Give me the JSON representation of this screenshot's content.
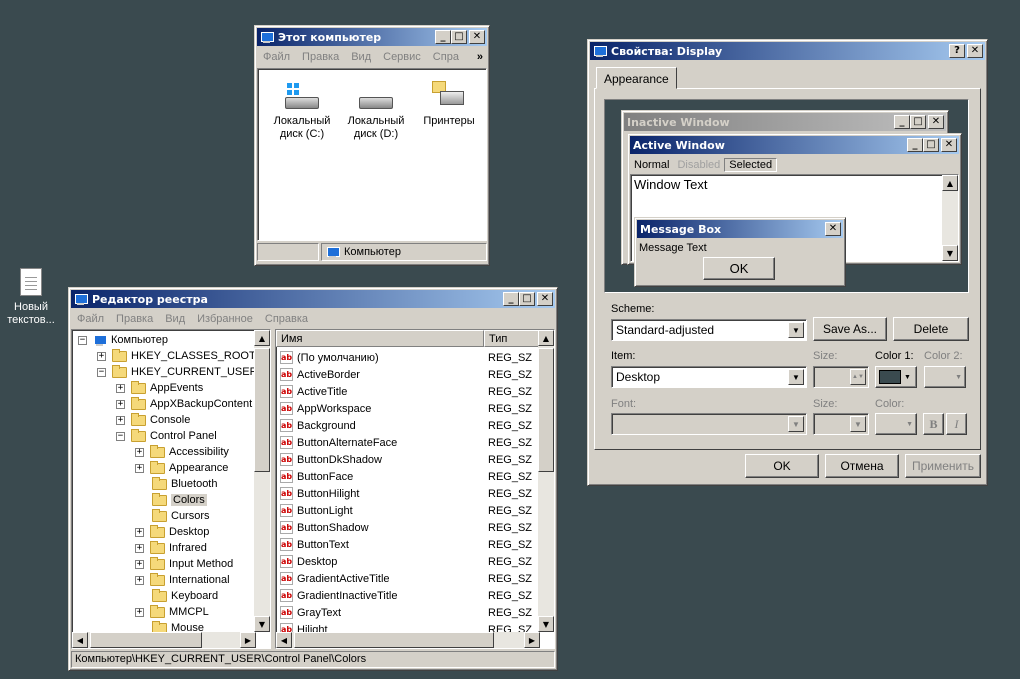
{
  "desktop": {
    "icon_label": "Новый текстов..."
  },
  "computer": {
    "title": "Этот компьютер",
    "menu": [
      "Файл",
      "Правка",
      "Вид",
      "Сервис",
      "Спра"
    ],
    "more": "»",
    "items": [
      "Локальный диск (C:)",
      "Локальный диск (D:)",
      "Принтеры"
    ],
    "status": "Компьютер"
  },
  "regedit": {
    "title": "Редактор реестра",
    "menu": [
      "Файл",
      "Правка",
      "Вид",
      "Избранное",
      "Справка"
    ],
    "tree": [
      {
        "label": "Компьютер",
        "lvl": 0,
        "exp": "−"
      },
      {
        "label": "HKEY_CLASSES_ROOT",
        "lvl": 1,
        "exp": "+"
      },
      {
        "label": "HKEY_CURRENT_USER",
        "lvl": 1,
        "exp": "−"
      },
      {
        "label": "AppEvents",
        "lvl": 2,
        "exp": "+"
      },
      {
        "label": "AppXBackupContent",
        "lvl": 2,
        "exp": "+"
      },
      {
        "label": "Console",
        "lvl": 2,
        "exp": "+"
      },
      {
        "label": "Control Panel",
        "lvl": 2,
        "exp": "−"
      },
      {
        "label": "Accessibility",
        "lvl": 3,
        "exp": "+"
      },
      {
        "label": "Appearance",
        "lvl": 3,
        "exp": "+"
      },
      {
        "label": "Bluetooth",
        "lvl": 3,
        "exp": ""
      },
      {
        "label": "Colors",
        "lvl": 3,
        "exp": "",
        "selected": true
      },
      {
        "label": "Cursors",
        "lvl": 3,
        "exp": ""
      },
      {
        "label": "Desktop",
        "lvl": 3,
        "exp": "+"
      },
      {
        "label": "Infrared",
        "lvl": 3,
        "exp": "+"
      },
      {
        "label": "Input Method",
        "lvl": 3,
        "exp": "+"
      },
      {
        "label": "International",
        "lvl": 3,
        "exp": "+"
      },
      {
        "label": "Keyboard",
        "lvl": 3,
        "exp": ""
      },
      {
        "label": "MMCPL",
        "lvl": 3,
        "exp": "+"
      },
      {
        "label": "Mouse",
        "lvl": 3,
        "exp": ""
      }
    ],
    "col_name": "Имя",
    "col_type": "Тип",
    "values": [
      {
        "name": "(По умолчанию)",
        "type": "REG_SZ"
      },
      {
        "name": "ActiveBorder",
        "type": "REG_SZ"
      },
      {
        "name": "ActiveTitle",
        "type": "REG_SZ"
      },
      {
        "name": "AppWorkspace",
        "type": "REG_SZ"
      },
      {
        "name": "Background",
        "type": "REG_SZ"
      },
      {
        "name": "ButtonAlternateFace",
        "type": "REG_SZ"
      },
      {
        "name": "ButtonDkShadow",
        "type": "REG_SZ"
      },
      {
        "name": "ButtonFace",
        "type": "REG_SZ"
      },
      {
        "name": "ButtonHilight",
        "type": "REG_SZ"
      },
      {
        "name": "ButtonLight",
        "type": "REG_SZ"
      },
      {
        "name": "ButtonShadow",
        "type": "REG_SZ"
      },
      {
        "name": "ButtonText",
        "type": "REG_SZ"
      },
      {
        "name": "Desktop",
        "type": "REG_SZ"
      },
      {
        "name": "GradientActiveTitle",
        "type": "REG_SZ"
      },
      {
        "name": "GradientInactiveTitle",
        "type": "REG_SZ"
      },
      {
        "name": "GrayText",
        "type": "REG_SZ"
      },
      {
        "name": "Hilight",
        "type": "REG_SZ"
      }
    ],
    "status": "Компьютер\\HKEY_CURRENT_USER\\Control Panel\\Colors"
  },
  "display": {
    "title": "Свойства: Display",
    "help": "?",
    "tab": "Appearance",
    "preview": {
      "inactive_title": "Inactive Window",
      "active_title": "Active Window",
      "menu_normal": "Normal",
      "menu_disabled": "Disabled",
      "menu_selected": "Selected",
      "window_text": "Window Text",
      "msgbox_title": "Message Box",
      "msgbox_text": "Message Text",
      "msgbox_ok": "OK"
    },
    "scheme_label": "Scheme:",
    "scheme_value": "Standard-adjusted",
    "save_as": "Save As...",
    "delete": "Delete",
    "item_label": "Item:",
    "item_value": "Desktop",
    "size_label": "Size:",
    "color1_label": "Color 1:",
    "color2_label": "Color 2:",
    "font_label": "Font:",
    "font_size_label": "Size:",
    "font_color_label": "Color:",
    "bold": "B",
    "italic": "I",
    "color1": "#3a4a4f",
    "ok": "OK",
    "cancel": "Отмена",
    "apply": "Применить"
  }
}
